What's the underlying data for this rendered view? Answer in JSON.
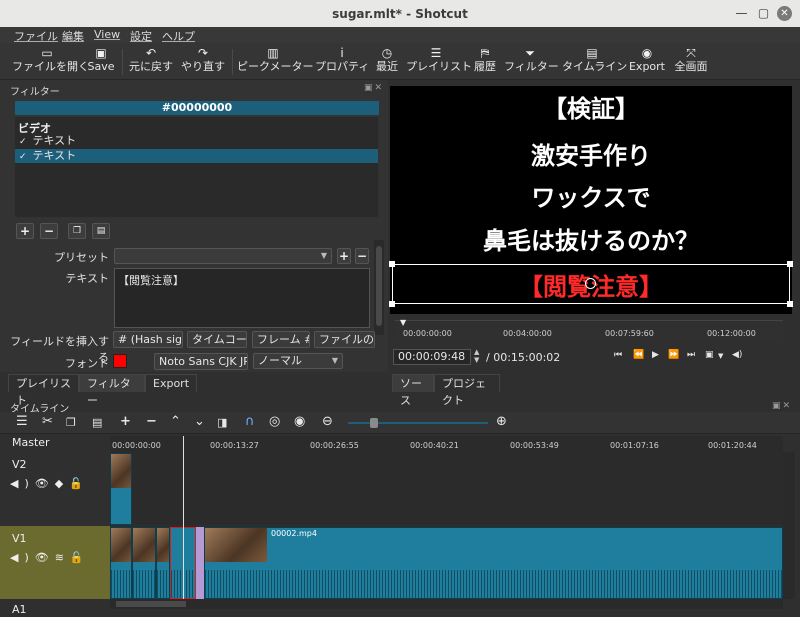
{
  "window": {
    "title": "sugar.mlt* - Shotcut"
  },
  "menubar": [
    "ファイル",
    "編集",
    "View",
    "設定",
    "ヘルプ"
  ],
  "toolbar": [
    {
      "label": "ファイルを開く",
      "icon": "folder-open-icon",
      "glyph": "▭"
    },
    {
      "label": "Save",
      "icon": "save-icon",
      "glyph": "▣"
    },
    {
      "label": "元に戻す",
      "icon": "undo-icon",
      "glyph": "↶"
    },
    {
      "label": "やり直す",
      "icon": "redo-icon",
      "glyph": "↷"
    },
    {
      "label": "ピークメーター",
      "icon": "peak-meter-icon",
      "glyph": "▥"
    },
    {
      "label": "プロパティ",
      "icon": "info-icon",
      "glyph": "i"
    },
    {
      "label": "最近",
      "icon": "clock-icon",
      "glyph": "◷"
    },
    {
      "label": "プレイリスト",
      "icon": "playlist-icon",
      "glyph": "☰"
    },
    {
      "label": "履歴",
      "icon": "history-icon",
      "glyph": "⛿"
    },
    {
      "label": "フィルター",
      "icon": "filter-icon",
      "glyph": "⏷"
    },
    {
      "label": "タイムライン",
      "icon": "timeline-icon",
      "glyph": "▤"
    },
    {
      "label": "Export",
      "icon": "export-icon",
      "glyph": "◉"
    },
    {
      "label": "全画面",
      "icon": "fullscreen-icon",
      "glyph": "⤧"
    }
  ],
  "filters": {
    "panel_title": "フィルター",
    "color_label": "#00000000",
    "list_header": "ビデオ",
    "items": [
      {
        "label": "テキスト",
        "checked": true,
        "selected": false
      },
      {
        "label": "テキスト",
        "checked": true,
        "selected": true
      }
    ],
    "preset_label": "プリセット",
    "preset_value": "",
    "text_label": "テキスト",
    "text_value": "【閲覧注意】",
    "insert_field_label": "フィールドを挿入する",
    "insert_buttons": [
      "# (Hash sign)",
      "タイムコード",
      "フレーム #",
      "ファイルの日"
    ],
    "font_label": "フォント",
    "font_color": "#ff0000",
    "font_name": "Noto Sans CJK JP",
    "font_weight": "ノーマル"
  },
  "left_tabs": [
    "プレイリスト",
    "フィルター",
    "Export"
  ],
  "player": {
    "lines": [
      "【検証】",
      "激安手作り",
      "ワックスで",
      "鼻毛は抜けるのか？",
      "【閲覧注意】"
    ],
    "ruler_ticks": [
      "00:00:00:00",
      "00:04:00:00",
      "00:07:59:60",
      "00:12:00:00"
    ],
    "timecode": "00:00:09:48",
    "duration": "/ 00:15:00:02",
    "tabs": [
      "ソース",
      "プロジェクト"
    ]
  },
  "timeline": {
    "panel_title": "タイムライン",
    "ruler_ticks": [
      "00:00:00:00",
      "00:00:13:27",
      "00:00:26:55",
      "00:00:40:21",
      "00:00:53:49",
      "00:01:07:16",
      "00:01:20:44"
    ],
    "tracks": [
      {
        "name": "Master"
      },
      {
        "name": "V2"
      },
      {
        "name": "V1",
        "clip_name": "00002.mp4"
      },
      {
        "name": "A1"
      }
    ]
  }
}
